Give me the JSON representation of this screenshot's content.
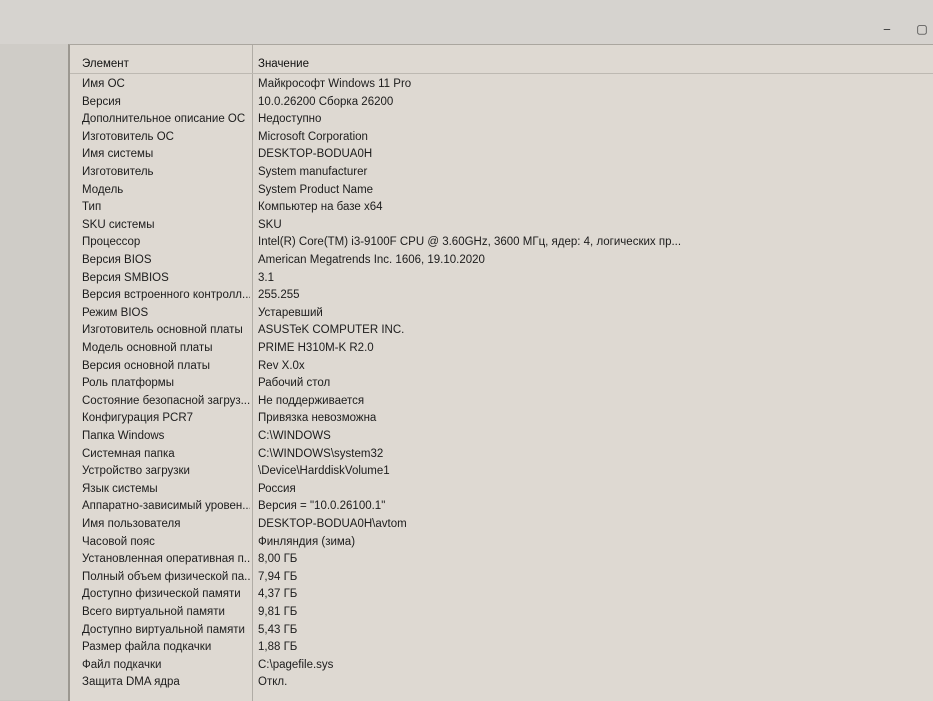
{
  "window": {
    "minimize_glyph": "‒",
    "maximize_glyph": "▢"
  },
  "header": {
    "col_element": "Элемент",
    "col_value": "Значение"
  },
  "rows": [
    {
      "element": "Имя ОС",
      "value": "Майкрософт Windows 11 Pro"
    },
    {
      "element": "Версия",
      "value": "10.0.26200 Сборка 26200"
    },
    {
      "element": "Дополнительное описание ОС",
      "value": "Недоступно"
    },
    {
      "element": "Изготовитель ОС",
      "value": "Microsoft Corporation"
    },
    {
      "element": "Имя системы",
      "value": "DESKTOP-BODUA0H"
    },
    {
      "element": "Изготовитель",
      "value": "System manufacturer"
    },
    {
      "element": "Модель",
      "value": "System Product Name"
    },
    {
      "element": "Тип",
      "value": "Компьютер на базе x64"
    },
    {
      "element": "SKU системы",
      "value": "SKU"
    },
    {
      "element": "Процессор",
      "value": "Intel(R) Core(TM) i3-9100F CPU @ 3.60GHz, 3600 МГц, ядер: 4, логических пр..."
    },
    {
      "element": "Версия BIOS",
      "value": "American Megatrends Inc. 1606, 19.10.2020"
    },
    {
      "element": "Версия SMBIOS",
      "value": "3.1"
    },
    {
      "element": "Версия встроенного контролл...",
      "value": "255.255"
    },
    {
      "element": "Режим BIOS",
      "value": "Устаревший"
    },
    {
      "element": "Изготовитель основной платы",
      "value": "ASUSTeK COMPUTER INC."
    },
    {
      "element": "Модель основной платы",
      "value": "PRIME H310M-K R2.0"
    },
    {
      "element": "Версия основной платы",
      "value": "Rev X.0x"
    },
    {
      "element": "Роль платформы",
      "value": "Рабочий стол"
    },
    {
      "element": "Состояние безопасной загруз...",
      "value": "Не поддерживается"
    },
    {
      "element": "Конфигурация PCR7",
      "value": "Привязка невозможна"
    },
    {
      "element": "Папка Windows",
      "value": "C:\\WINDOWS"
    },
    {
      "element": "Системная папка",
      "value": "C:\\WINDOWS\\system32"
    },
    {
      "element": "Устройство загрузки",
      "value": "\\Device\\HarddiskVolume1"
    },
    {
      "element": "Язык системы",
      "value": "Россия"
    },
    {
      "element": "Аппаратно-зависимый уровен...",
      "value": "Версия = \"10.0.26100.1\""
    },
    {
      "element": "Имя пользователя",
      "value": "DESKTOP-BODUA0H\\avtom"
    },
    {
      "element": "Часовой пояс",
      "value": "Финляндия (зима)"
    },
    {
      "element": "Установленная оперативная п...",
      "value": "8,00 ГБ"
    },
    {
      "element": "Полный объем физической па...",
      "value": "7,94 ГБ"
    },
    {
      "element": "Доступно физической памяти",
      "value": "4,37 ГБ"
    },
    {
      "element": "Всего виртуальной памяти",
      "value": "9,81 ГБ"
    },
    {
      "element": "Доступно виртуальной памяти",
      "value": "5,43 ГБ"
    },
    {
      "element": "Размер файла подкачки",
      "value": "1,88 ГБ"
    },
    {
      "element": "Файл подкачки",
      "value": "C:\\pagefile.sys"
    },
    {
      "element": "Защита DMA ядра",
      "value": "Откл."
    }
  ]
}
